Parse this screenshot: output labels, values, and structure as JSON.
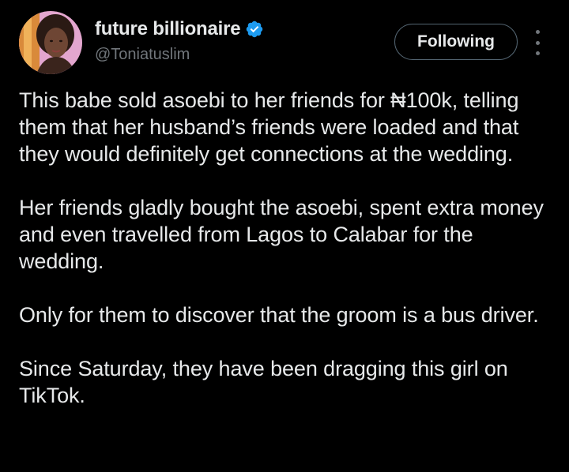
{
  "author": {
    "display_name": "future billionaire",
    "handle": "@Toniatuslim",
    "verified": true
  },
  "actions": {
    "follow_label": "Following"
  },
  "icons": {
    "verified": "verified-badge-icon",
    "more": "more-options-icon"
  },
  "colors": {
    "background": "#000000",
    "text": "#e7e9ea",
    "secondary_text": "#71767b",
    "verified_blue": "#1d9bf0"
  },
  "tweet": {
    "paragraphs": [
      "This babe sold asoebi to her friends for ₦100k, telling them that her husband’s friends were loaded and that they would definitely get connections at the wedding.",
      "Her friends gladly bought the asoebi, spent extra money and even travelled from Lagos to Calabar for the wedding.",
      "Only for them to discover that the groom is a bus driver.",
      "Since Saturday, they have been dragging this girl on TikTok."
    ]
  }
}
